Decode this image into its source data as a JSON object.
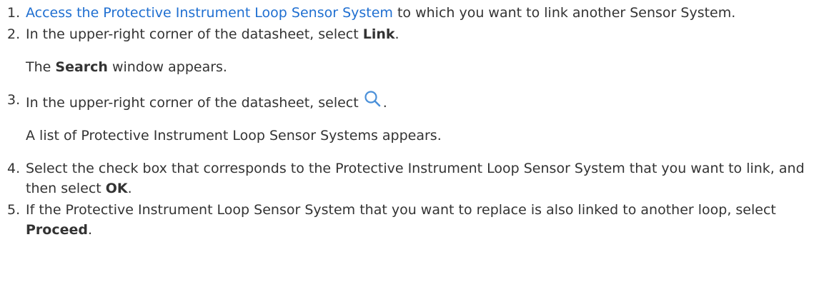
{
  "steps": [
    {
      "num": "1.",
      "link": "Access the Protective Instrument Loop Sensor System",
      "rest": " to which you want to link another Sensor System."
    },
    {
      "num": "2.",
      "pre": "In the upper-right corner of the datasheet, select ",
      "bold": "Link",
      "post": ".",
      "result_pre": "The ",
      "result_bold": "Search",
      "result_post": " window appears."
    },
    {
      "num": "3.",
      "pre": "In the upper-right corner of the datasheet, select ",
      "icon": "search-icon",
      "post": ".",
      "result": "A list of Protective Instrument Loop Sensor Systems appears."
    },
    {
      "num": "4.",
      "pre": "Select the check box that corresponds to the Protective Instrument Loop Sensor System that you want to link, and then select ",
      "bold": "OK",
      "post": "."
    },
    {
      "num": "5.",
      "pre": "If the Protective Instrument Loop Sensor System that you want to replace is also linked to another loop, select ",
      "bold": "Proceed",
      "post": "."
    }
  ],
  "colors": {
    "link": "#1f6fd1",
    "text": "#333333",
    "icon": "#4a90d9"
  }
}
